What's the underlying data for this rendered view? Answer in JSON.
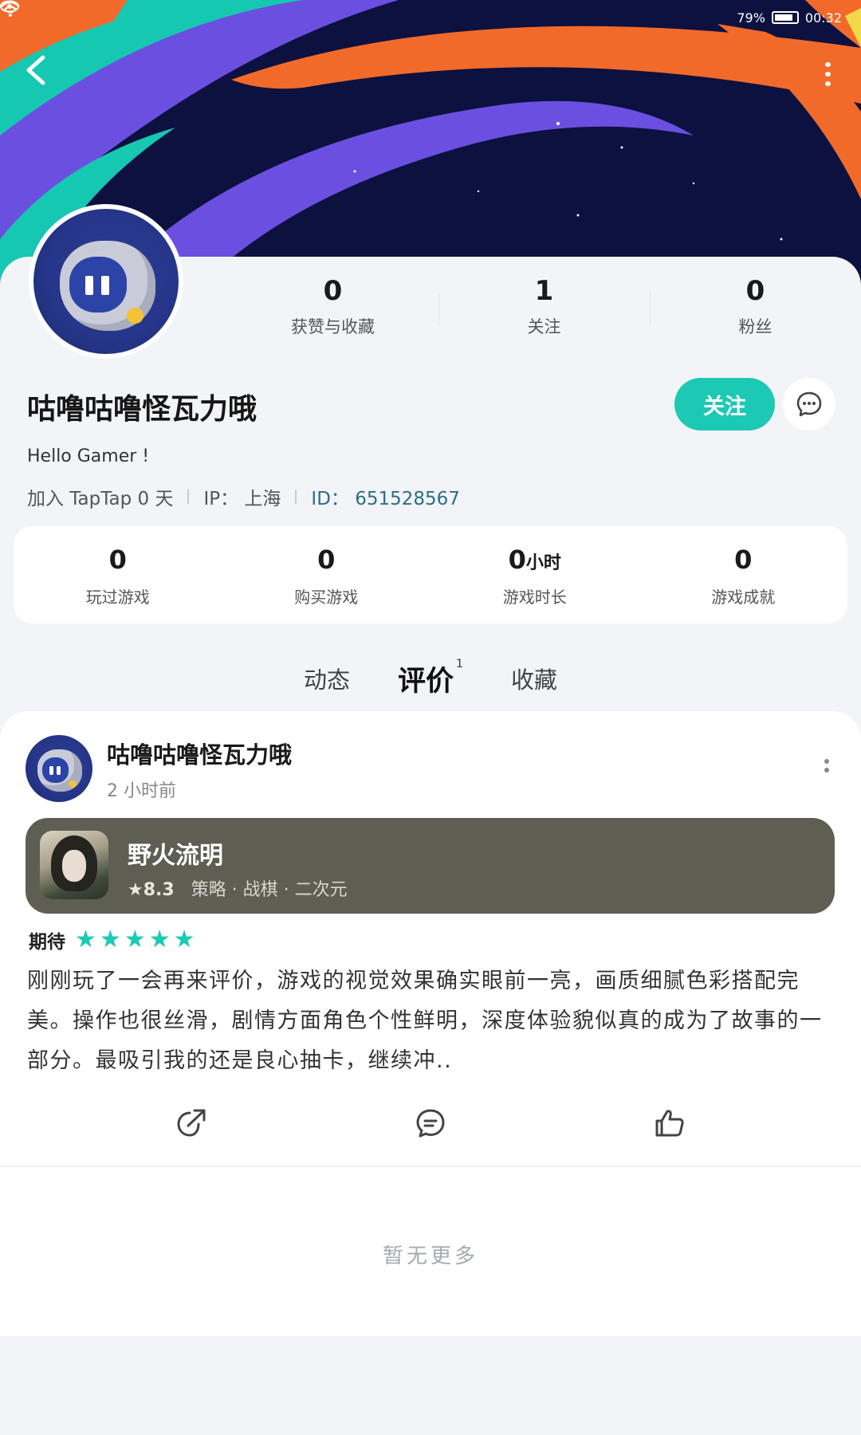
{
  "status_bar": {
    "battery": "79%",
    "time": "00:32"
  },
  "profile": {
    "username": "咕噜咕噜怪瓦力哦",
    "bio": "Hello Gamer !",
    "joined": "加入 TapTap 0 天",
    "ip": "IP： 上海",
    "id": "ID： 651528567",
    "follow_label": "关注",
    "stats": [
      {
        "value": "0",
        "label": "获赞与收藏"
      },
      {
        "value": "1",
        "label": "关注"
      },
      {
        "value": "0",
        "label": "粉丝"
      }
    ]
  },
  "game_stats": [
    {
      "value": "0",
      "unit": "",
      "label": "玩过游戏"
    },
    {
      "value": "0",
      "unit": "",
      "label": "购买游戏"
    },
    {
      "value": "0",
      "unit": "小时",
      "label": "游戏时长"
    },
    {
      "value": "0",
      "unit": "",
      "label": "游戏成就"
    }
  ],
  "tabs": [
    {
      "label": "动态",
      "badge": ""
    },
    {
      "label": "评价",
      "badge": "1"
    },
    {
      "label": "收藏",
      "badge": ""
    }
  ],
  "review": {
    "user": "咕噜咕噜怪瓦力哦",
    "time": "2 小时前",
    "game": {
      "title": "野火流明",
      "score": "★8.3",
      "tags": "策略 · 战棋 · 二次元"
    },
    "rating_label": "期待",
    "stars": 5,
    "text": "刚刚玩了一会再来评价，游戏的视觉效果确实眼前一亮，画质细腻色彩搭配完美。操作也很丝滑，剧情方面角色个性鲜明，深度体验貌似真的成为了故事的一部分。最吸引我的还是良心抽卡，继续冲.."
  },
  "footer": {
    "no_more": "暂无更多"
  },
  "colors": {
    "accent": "#1cc9b5",
    "banner_bg": "#0c1140",
    "stripe_orange": "#f26a2a",
    "stripe_teal": "#16c7b2",
    "stripe_purple": "#6b4fe0",
    "game_chip_bg": "#5e5e53"
  }
}
